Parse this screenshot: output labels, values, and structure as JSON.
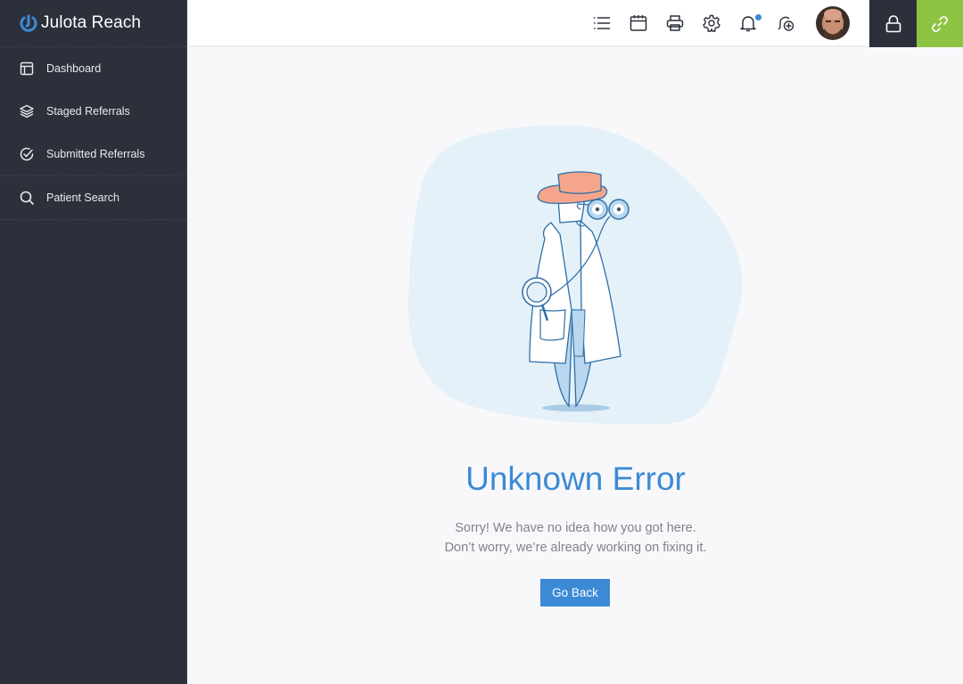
{
  "app": {
    "title": "Julota Reach",
    "logo_icon": "julota-logo-icon"
  },
  "sidebar": {
    "items": [
      {
        "label": "Dashboard",
        "icon": "layout-icon"
      },
      {
        "label": "Staged Referrals",
        "icon": "layers-icon"
      },
      {
        "label": "Submitted Referrals",
        "icon": "check-circle-icon"
      },
      {
        "label": "Patient Search",
        "icon": "search-icon"
      }
    ]
  },
  "topbar": {
    "icons": [
      "list-icon",
      "calendar-icon",
      "printer-icon",
      "gear-icon",
      "bell-icon",
      "bell-plus-icon"
    ],
    "notification_dot": true,
    "lock_icon": "lock-icon",
    "link_icon": "link-icon"
  },
  "colors": {
    "accent": "#3c8ad6",
    "sidebar": "#2c303a",
    "link_button": "#8dc343",
    "hat": "#f4a58a"
  },
  "error": {
    "title": "Unknown Error",
    "line1": "Sorry! We have no idea how you got here.",
    "line2": "Don’t worry, we’re already working on fixing it.",
    "button": "Go Back"
  }
}
